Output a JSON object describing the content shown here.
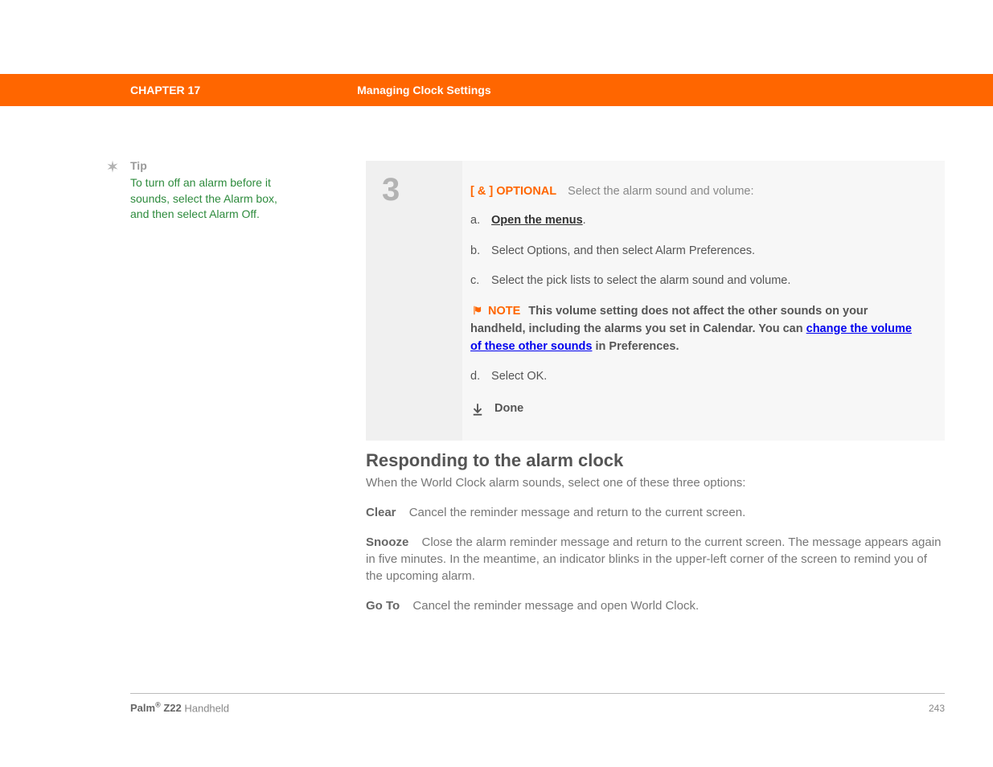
{
  "header": {
    "chapter": "CHAPTER 17",
    "title": "Managing Clock Settings"
  },
  "tip": {
    "label": "Tip",
    "body": "To turn off an alarm before it sounds, select the Alarm box, and then select Alarm Off."
  },
  "step": {
    "number": "3",
    "optional_tag": "[ & ]  OPTIONAL",
    "optional_desc": "Select the alarm sound and volume:",
    "items": {
      "a_marker": "a.",
      "a_link": "Open the menus",
      "a_suffix": ".",
      "b_marker": "b.",
      "b_text": "Select Options, and then select Alarm Preferences.",
      "c_marker": "c.",
      "c_text": "Select the pick lists to select the alarm sound and volume."
    },
    "note": {
      "label": "NOTE",
      "text_before_link": "This volume setting does not affect the other sounds on your handheld, including the alarms you set in Calendar. You can ",
      "link": "change the volume of these other sounds",
      "text_after_link": " in Preferences."
    },
    "item_d": {
      "marker": "d.",
      "text": "Select OK."
    },
    "done": "Done"
  },
  "section": {
    "heading": "Responding to the alarm clock",
    "intro": "When the World Clock alarm sounds, select one of these three options:",
    "options": [
      {
        "label": "Clear",
        "desc": "Cancel the reminder message and return to the current screen."
      },
      {
        "label": "Snooze",
        "desc": "Close the alarm reminder message and return to the current screen. The message appears again in five minutes. In the meantime, an indicator blinks in the upper-left corner of the screen to remind you of the upcoming alarm."
      },
      {
        "label": "Go To",
        "desc": "Cancel the reminder message and open World Clock."
      }
    ]
  },
  "footer": {
    "product_prefix": "Palm",
    "product_reg": "®",
    "product_model": " Z22",
    "product_suffix": " Handheld",
    "page": "243"
  }
}
